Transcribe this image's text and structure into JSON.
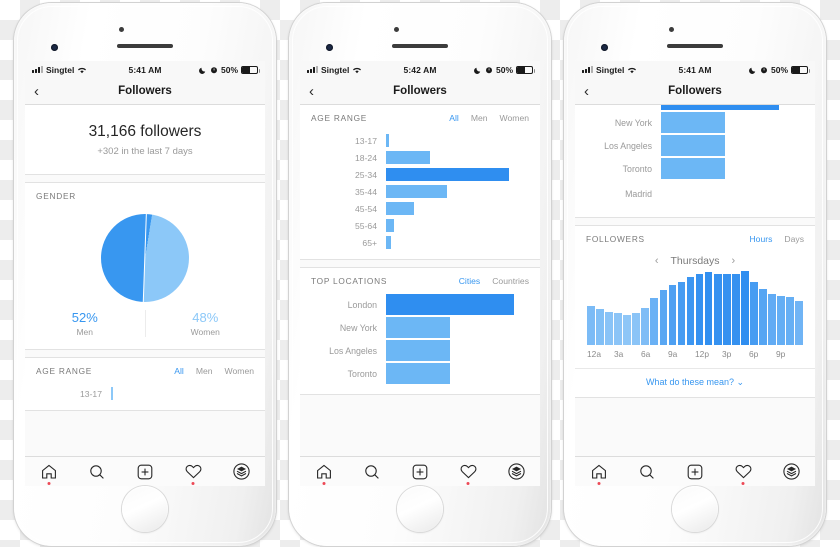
{
  "meta": {
    "accent_blue": "#3897f0",
    "bar_light": "#6cb7f5",
    "bar_lighter": "#8cc8f8",
    "bar_dark": "#2f8ef0",
    "notif_red": "#ed4956"
  },
  "phones": [
    {
      "status": {
        "carrier": "Singtel",
        "time": "5:41 AM",
        "battery": "50%",
        "moon_icon": "crescent-moon-icon",
        "alarm_icon": "alarm-clock-icon",
        "wifi_icon": "wifi-icon",
        "signal_icon": "cellular-signal-icon"
      },
      "nav": {
        "back_icon": "chevron-left-icon",
        "title": "Followers"
      },
      "summary": {
        "count": "31,166 followers",
        "change": "+302 in the last 7 days"
      },
      "gender": {
        "title": "GENDER",
        "men_pct": "52%",
        "men_label": "Men",
        "women_pct": "48%",
        "women_label": "Women"
      },
      "age": {
        "title": "AGE RANGE",
        "tabs": [
          {
            "label": "All",
            "active": true
          },
          {
            "label": "Men",
            "active": false
          },
          {
            "label": "Women",
            "active": false
          }
        ],
        "rows": [
          {
            "label": "13-17",
            "value": 1
          }
        ]
      }
    },
    {
      "status": {
        "carrier": "Singtel",
        "time": "5:42 AM",
        "battery": "50%"
      },
      "nav": {
        "title": "Followers"
      },
      "age": {
        "title": "AGE RANGE",
        "tabs": [
          {
            "label": "All",
            "active": true
          },
          {
            "label": "Men",
            "active": false
          },
          {
            "label": "Women",
            "active": false
          }
        ],
        "rows": [
          {
            "label": "13-17",
            "value": 2
          },
          {
            "label": "18-24",
            "value": 34
          },
          {
            "label": "25-34",
            "value": 96,
            "highlight": true
          },
          {
            "label": "35-44",
            "value": 48
          },
          {
            "label": "45-54",
            "value": 22
          },
          {
            "label": "55-64",
            "value": 6
          },
          {
            "label": "65+",
            "value": 4
          }
        ]
      },
      "locations": {
        "title": "TOP LOCATIONS",
        "tabs": [
          {
            "label": "Cities",
            "active": true
          },
          {
            "label": "Countries",
            "active": false
          }
        ],
        "rows": [
          {
            "label": "London",
            "value": 100,
            "highlight": true
          },
          {
            "label": "New York",
            "value": 50
          },
          {
            "label": "Los Angeles",
            "value": 50
          },
          {
            "label": "Toronto",
            "value": 50
          }
        ]
      }
    },
    {
      "status": {
        "carrier": "Singtel",
        "time": "5:41 AM",
        "battery": "50%"
      },
      "nav": {
        "title": "Followers"
      },
      "locations": {
        "rows": [
          {
            "label": "New York",
            "value": 50
          },
          {
            "label": "Los Angeles",
            "value": 50
          },
          {
            "label": "Toronto",
            "value": 50
          },
          {
            "label": "Madrid",
            "value": 0
          }
        ]
      },
      "followers_hours": {
        "title": "FOLLOWERS",
        "tabs": [
          {
            "label": "Hours",
            "active": true
          },
          {
            "label": "Days",
            "active": false
          }
        ],
        "day": "Thursdays",
        "prev_icon": "chevron-left-icon",
        "next_icon": "chevron-right-icon",
        "footer_link": "What do these mean?",
        "footer_icon": "chevron-down-icon"
      }
    }
  ],
  "tabbar": {
    "items": [
      {
        "name": "home-icon",
        "badge": true
      },
      {
        "name": "search-icon",
        "badge": false
      },
      {
        "name": "add-post-icon",
        "badge": false
      },
      {
        "name": "activity-heart-icon",
        "badge": true
      },
      {
        "name": "profile-icon",
        "badge": false
      }
    ]
  },
  "chart_data": [
    {
      "type": "bar",
      "orientation": "horizontal",
      "title": "AGE RANGE",
      "categories": [
        "13-17",
        "18-24",
        "25-34",
        "35-44",
        "45-54",
        "55-64",
        "65+"
      ],
      "values": [
        2,
        34,
        96,
        48,
        22,
        6,
        4
      ],
      "xlabel": "",
      "ylabel": "",
      "legend": "none",
      "grid": false,
      "notes": "25-34 is the tallest bar and rendered in the darker accent blue"
    },
    {
      "type": "pie",
      "title": "GENDER",
      "categories": [
        "Men",
        "Women"
      ],
      "values": [
        52,
        48
      ],
      "colors": [
        "#3897f0",
        "#8cc8f8"
      ],
      "legend": "below-slices"
    },
    {
      "type": "bar",
      "orientation": "horizontal",
      "title": "TOP LOCATIONS",
      "categories": [
        "London",
        "New York",
        "Los Angeles",
        "Toronto",
        "Madrid"
      ],
      "values": [
        100,
        50,
        50,
        50,
        0
      ],
      "legend": "none",
      "grid": false,
      "notes": "London is the longest bar and uses the darker accent blue"
    },
    {
      "type": "bar",
      "orientation": "vertical",
      "title": "FOLLOWERS",
      "subtitle": "Thursdays",
      "categories": [
        "12a",
        "1a",
        "2a",
        "3a",
        "4a",
        "5a",
        "6a",
        "7a",
        "8a",
        "9a",
        "10a",
        "11a",
        "12p",
        "1p",
        "2p",
        "3p",
        "4p",
        "5p",
        "6p",
        "7p",
        "8p",
        "9p",
        "10p",
        "11p"
      ],
      "tick_labels": [
        "12a",
        "3a",
        "6a",
        "9a",
        "12p",
        "3p",
        "6p",
        "9p"
      ],
      "values": [
        44,
        41,
        37,
        36,
        34,
        36,
        42,
        53,
        62,
        68,
        72,
        77,
        81,
        83,
        81,
        81,
        81,
        84,
        72,
        64,
        58,
        56,
        55,
        50
      ],
      "ylim": [
        0,
        100
      ],
      "grid": false,
      "legend": "none",
      "notes": "Bar shade deepens toward midday; lighter blue at the extremes"
    }
  ]
}
